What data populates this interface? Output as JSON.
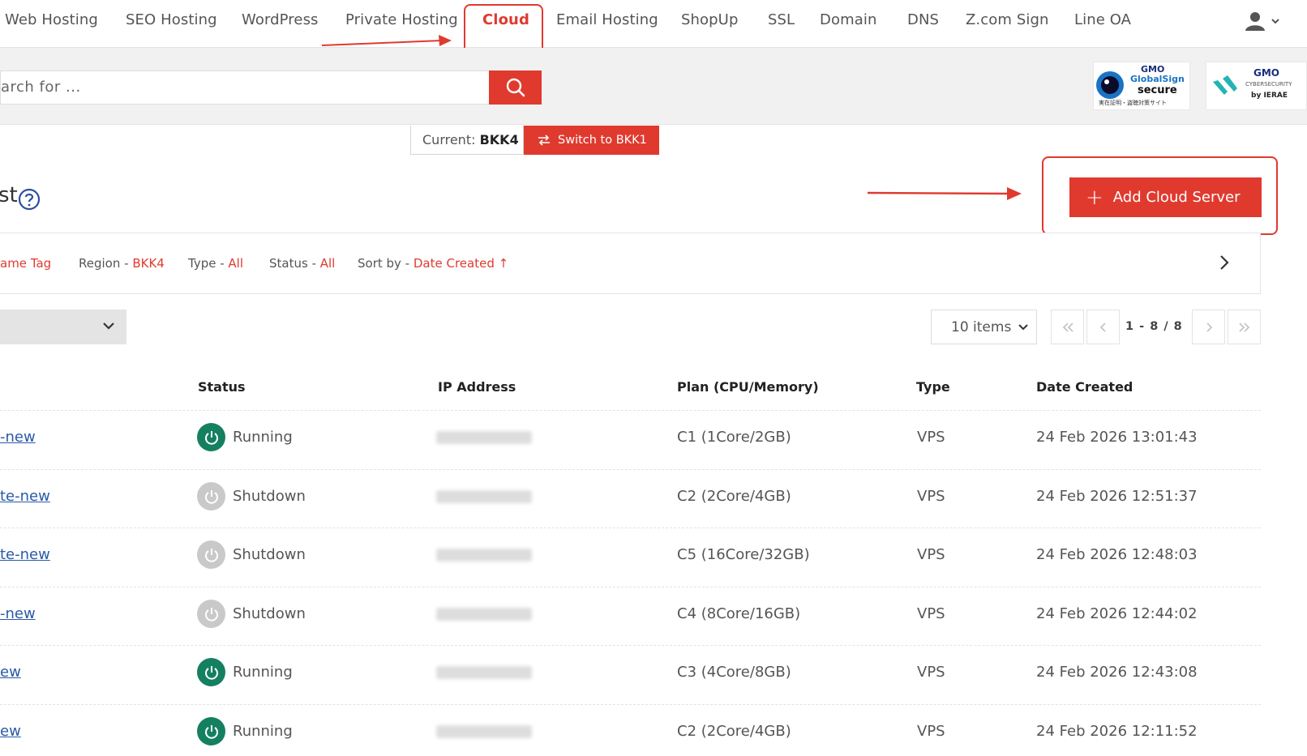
{
  "nav": {
    "items": [
      "Web Hosting",
      "SEO Hosting",
      "WordPress",
      "Private Hosting",
      "Cloud",
      "Email Hosting",
      "ShopUp",
      "SSL",
      "Domain",
      "DNS",
      "Z.com Sign",
      "Line OA"
    ],
    "active": "Cloud"
  },
  "search": {
    "value": "arch for ..."
  },
  "badges": {
    "globalsign": {
      "line1": "GMO",
      "line2": "GlobalSign",
      "line3": "secure",
      "line4": "実在証明・盗聴対策サイト"
    },
    "ierae": {
      "line1": "GMO",
      "line2": "CYBERSECURITY",
      "line3": "by IERAE"
    }
  },
  "region": {
    "current_label": "Current:",
    "current_value": "BKK4",
    "switch_label": "Switch to BKK1"
  },
  "page": {
    "heading": "st"
  },
  "add_button": {
    "label": "Add Cloud Server"
  },
  "filters": [
    {
      "label": "",
      "value": "ame Tag"
    },
    {
      "label": "Region - ",
      "value": "BKK4"
    },
    {
      "label": "Type - ",
      "value": "All"
    },
    {
      "label": "Status - ",
      "value": "All"
    },
    {
      "label": "Sort by - ",
      "value": "Date Created ↑"
    }
  ],
  "pagination": {
    "page_size": "10 items",
    "range": "1 - 8 / 8"
  },
  "table": {
    "headers": {
      "status": "Status",
      "ip": "IP Address",
      "plan": "Plan (CPU/Memory)",
      "type": "Type",
      "date": "Date Created"
    },
    "rows": [
      {
        "name": "-new",
        "status": "Running",
        "plan": "C1 (1Core/2GB)",
        "type": "VPS",
        "date": "24 Feb 2026 13:01:43"
      },
      {
        "name": "te-new",
        "status": "Shutdown",
        "plan": "C2 (2Core/4GB)",
        "type": "VPS",
        "date": "24 Feb 2026 12:51:37"
      },
      {
        "name": "te-new",
        "status": "Shutdown",
        "plan": "C5 (16Core/32GB)",
        "type": "VPS",
        "date": "24 Feb 2026 12:48:03"
      },
      {
        "name": "-new",
        "status": "Shutdown",
        "plan": "C4 (8Core/16GB)",
        "type": "VPS",
        "date": "24 Feb 2026 12:44:02"
      },
      {
        "name": "ew",
        "status": "Running",
        "plan": "C3 (4Core/8GB)",
        "type": "VPS",
        "date": "24 Feb 2026 12:43:08"
      },
      {
        "name": "ew",
        "status": "Running",
        "plan": "C2 (2Core/4GB)",
        "type": "VPS",
        "date": "24 Feb 2026 12:11:52"
      }
    ]
  },
  "colors": {
    "accent": "#e03a2f",
    "running": "#148060",
    "shutdown": "#c9c9c9",
    "link": "#2a5aa8"
  },
  "icons": {
    "search": "search-icon",
    "user": "user-icon",
    "switch": "swap-icon",
    "help": "help-circle-icon",
    "power": "power-icon",
    "plus": "plus-icon"
  }
}
